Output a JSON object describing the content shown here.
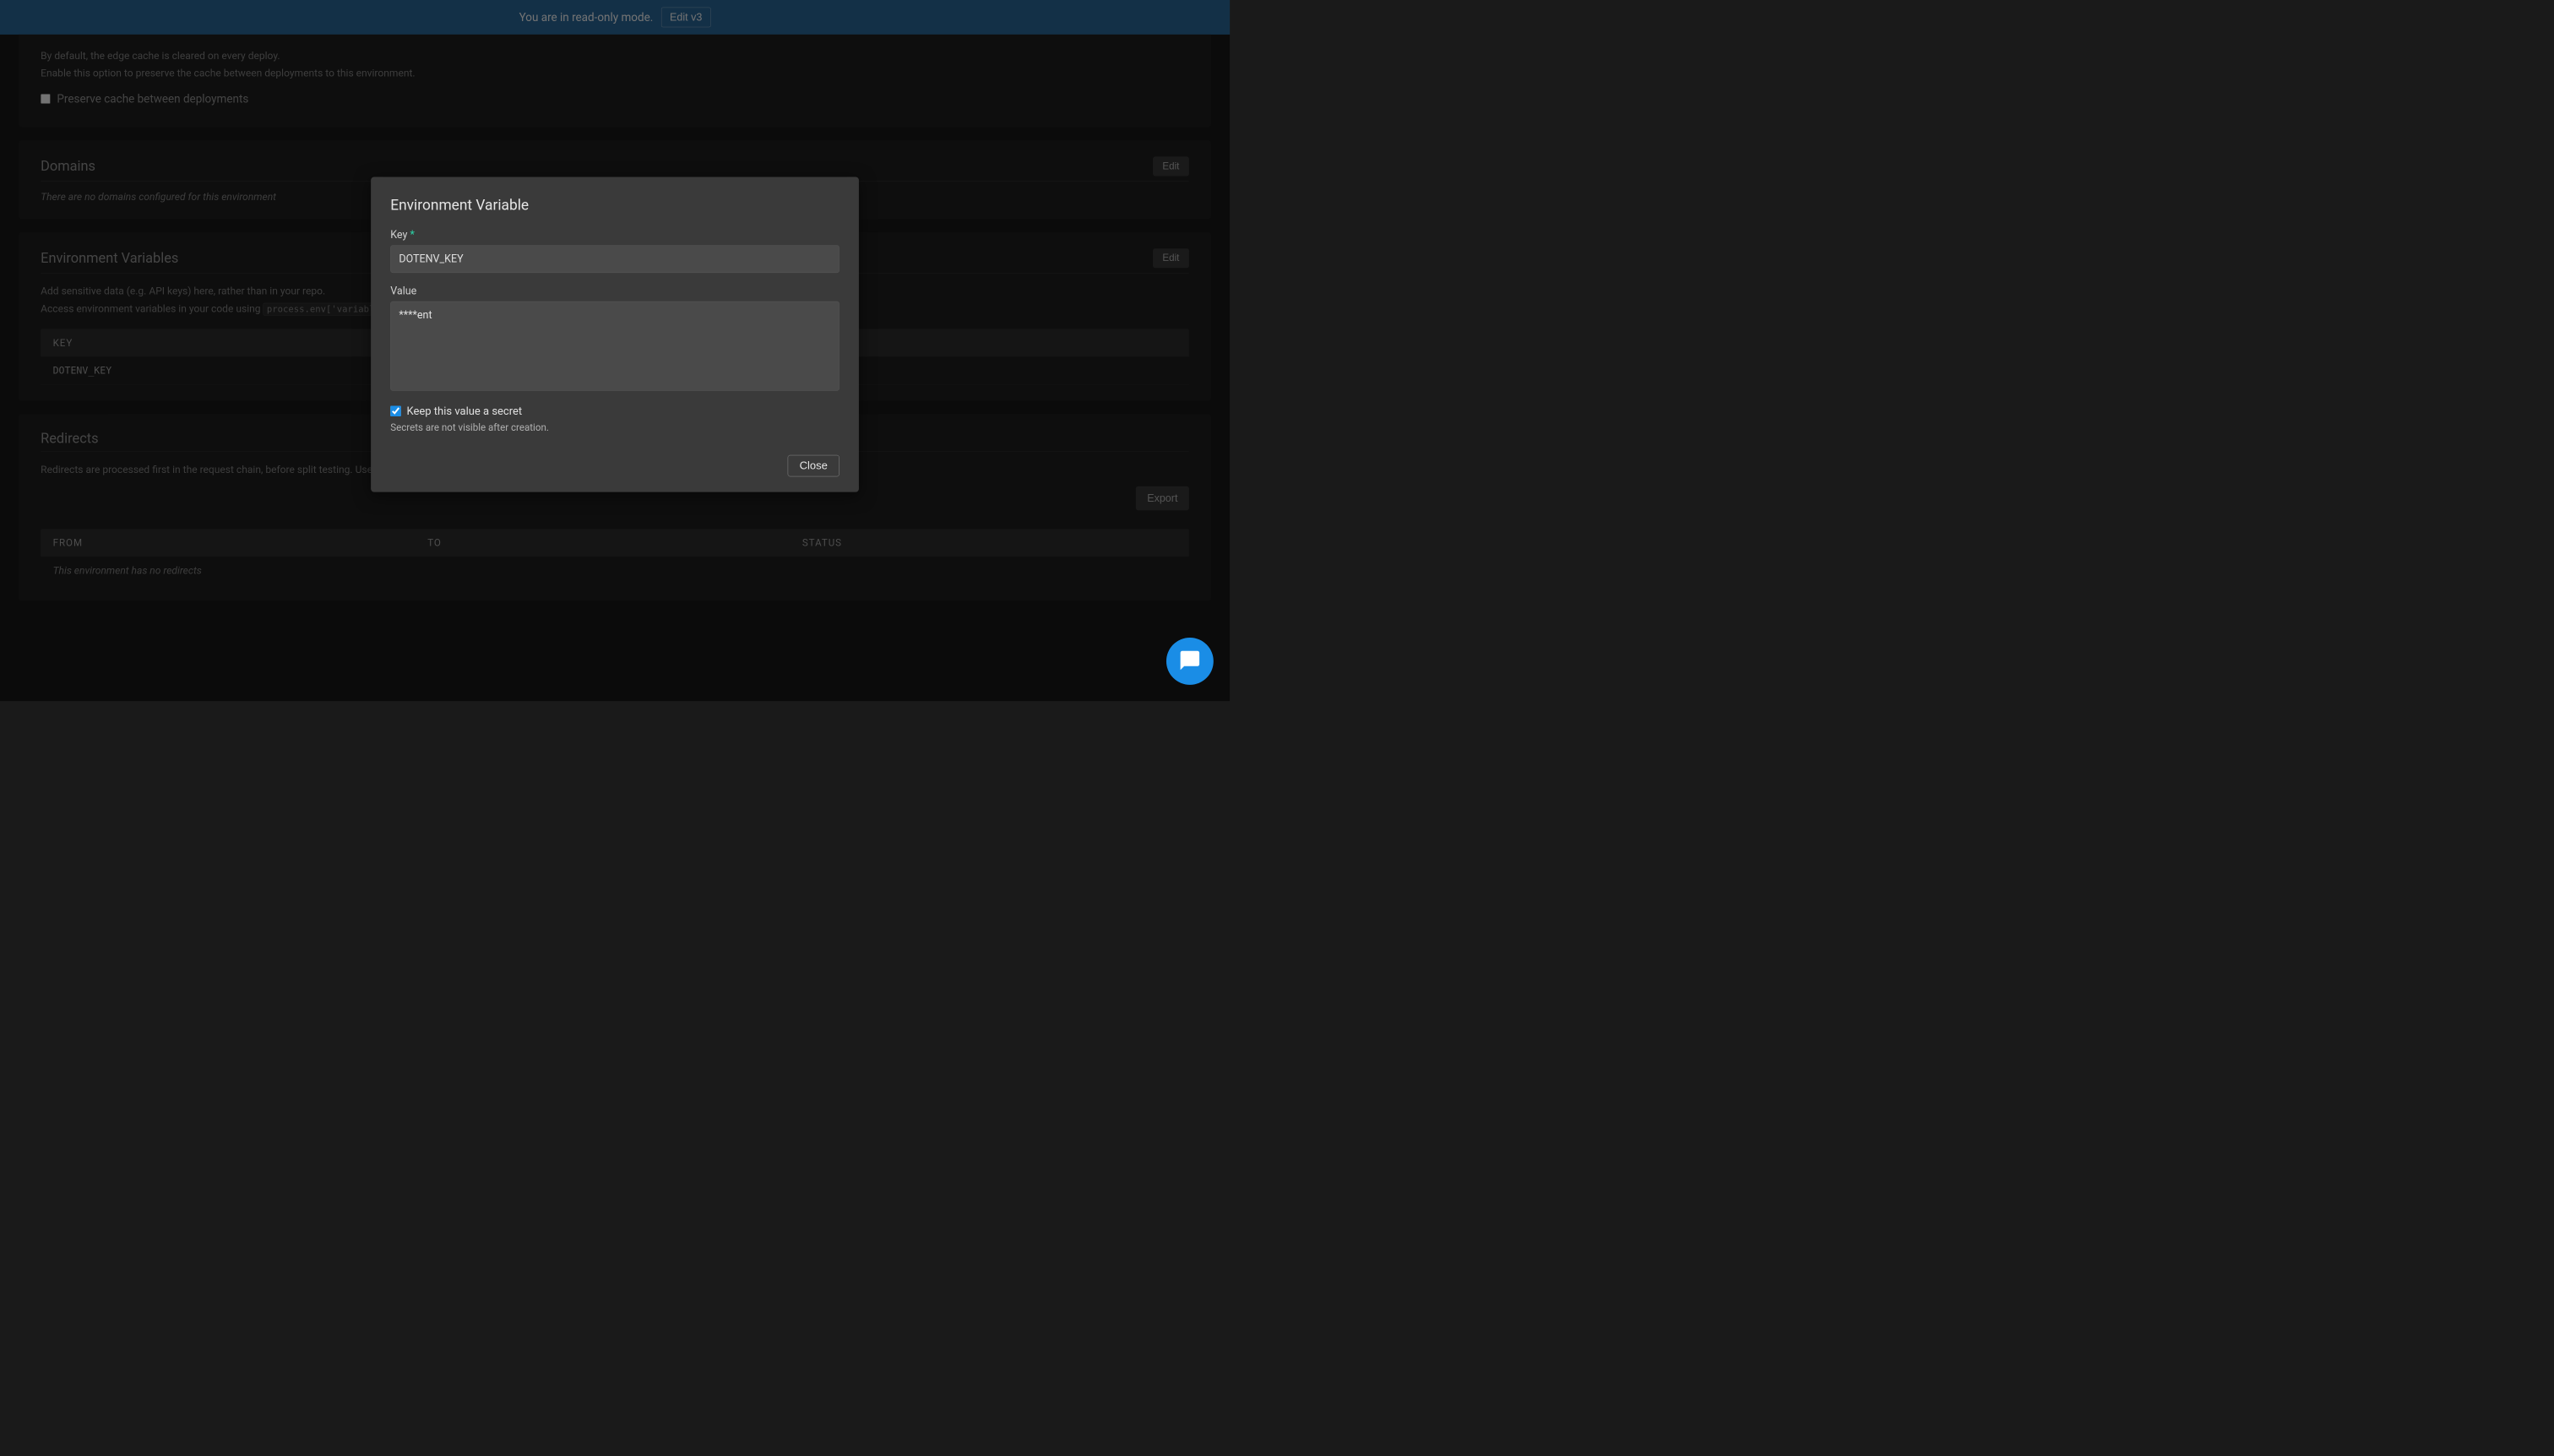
{
  "banner": {
    "message": "You are in read-only mode.",
    "button": "Edit v3"
  },
  "cache": {
    "line1": "By default, the edge cache is cleared on every deploy.",
    "line2": "Enable this option to preserve the cache between deployments to this environment.",
    "checkbox_label": "Preserve cache between deployments"
  },
  "domains": {
    "title": "Domains",
    "edit": "Edit",
    "empty": "There are no domains configured for this environment"
  },
  "envvars": {
    "title": "Environment Variables",
    "edit": "Edit",
    "desc_line1": "Add sensitive data (e.g. API keys) here, rather than in your repo.",
    "desc_line2_prefix": "Access environment variables in your code using ",
    "desc_code": "process.env['variablename']",
    "col_key": "KEY",
    "rows": [
      {
        "key": "DOTENV_KEY"
      }
    ]
  },
  "redirects": {
    "title": "Redirects",
    "desc": "Redirects are processed first in the request chain, before split testing. Use this feature to temporarily or permanently redirect traffic away specific pages.",
    "export": "Export",
    "col_from": "FROM",
    "col_to": "TO",
    "col_status": "STATUS",
    "empty": "This environment has no redirects"
  },
  "modal": {
    "title": "Environment Variable",
    "key_label": "Key",
    "key_value": "DOTENV_KEY",
    "value_label": "Value",
    "value_value": "****ent",
    "secret_label": "Keep this value a secret",
    "secret_hint": "Secrets are not visible after creation.",
    "close": "Close"
  }
}
